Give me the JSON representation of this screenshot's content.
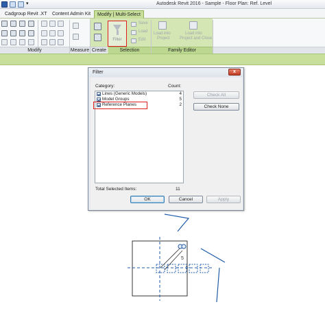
{
  "app": {
    "title": "Autodesk Revit 2016 -    Sample - Floor Plan: Ref. Level"
  },
  "tabs": [
    {
      "label": "Cadgroup Revit .XT",
      "active": false
    },
    {
      "label": "Content Admin Kit",
      "active": false
    },
    {
      "label": "Modify | Multi-Select",
      "active": true
    }
  ],
  "ribbon": {
    "panels": {
      "modify": "Modify",
      "measure": "Measure",
      "create": "Create",
      "selection": "Selection",
      "family_editor": "Family Editor"
    },
    "filter_label": "Filter",
    "save_label": "Save",
    "load_label": "Load",
    "edit_label": "Edit",
    "load_into_project": [
      "Load into",
      "Project"
    ],
    "load_into_project_close": [
      "Load into",
      "Project and Close"
    ]
  },
  "dialog": {
    "title": "Filter",
    "close_glyph": "x",
    "category_header": "Category:",
    "count_header": "Count:",
    "categories": [
      {
        "label": "Lines (Generic Models)",
        "count": "4",
        "checked": true
      },
      {
        "label": "Model Groups",
        "count": "5",
        "checked": true
      },
      {
        "label": "Reference Planes",
        "count": "2",
        "checked": true
      }
    ],
    "total_label": "Total Selected Items:",
    "total_value": "11",
    "check_all": "Check All",
    "check_none": "Check None",
    "ok": "OK",
    "cancel": "Cancel",
    "apply": "Apply"
  },
  "canvas": {
    "group_number": "5"
  },
  "colors": {
    "accent_green": "#c8df9c",
    "highlight_red": "#e01b1b",
    "selection_blue": "#1e5aa8"
  }
}
